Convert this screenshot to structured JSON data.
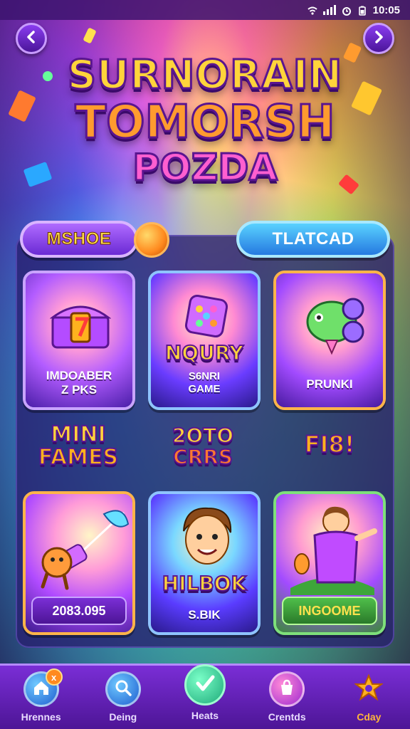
{
  "status_bar": {
    "time": "10:05"
  },
  "title": {
    "line1": "SURNORAIN",
    "line2": "TOMORSH",
    "line3": "POZDA"
  },
  "tabs": {
    "left_label": "MSHOE",
    "right_label": "TLATCAD"
  },
  "cards": [
    {
      "caption_line1": "IMDOABER",
      "caption_line2": "Z PKS",
      "icon": "treasure-chest-icon"
    },
    {
      "title": "NQURY",
      "caption_line1": "S6NRI",
      "caption_line2": "GAME",
      "icon": "dice-icon"
    },
    {
      "caption_line1": "PRUNKI",
      "icon": "green-robot-icon"
    },
    {
      "plate_label": "2083.095",
      "icon": "ice-cream-cat-icon"
    },
    {
      "title": "HILBOK",
      "caption_line1": "S.BIK",
      "icon": "boy-character-icon"
    },
    {
      "plate_label": "INGOOME",
      "icon": "caped-hero-icon"
    }
  ],
  "deco_labels": {
    "left_line1": "MINI",
    "left_line2": "FAMES",
    "center_line1": "2OTO",
    "center_line2": "CRRS",
    "right": "FI8!"
  },
  "bottom_nav": [
    {
      "label": "Hrennes",
      "icon": "home-icon",
      "badge": "x"
    },
    {
      "label": "Deing",
      "icon": "search-icon"
    },
    {
      "label": "Heats",
      "icon": "check-icon"
    },
    {
      "label": "Crentds",
      "icon": "bag-icon"
    },
    {
      "label": "Cday",
      "icon": "star-icon"
    }
  ],
  "colors": {
    "accent_purple": "#6a2ad4",
    "accent_blue": "#2579e0",
    "title_yellow": "#ffd43b",
    "title_orange": "#ff9b2f",
    "title_pink": "#ff5fd0"
  }
}
